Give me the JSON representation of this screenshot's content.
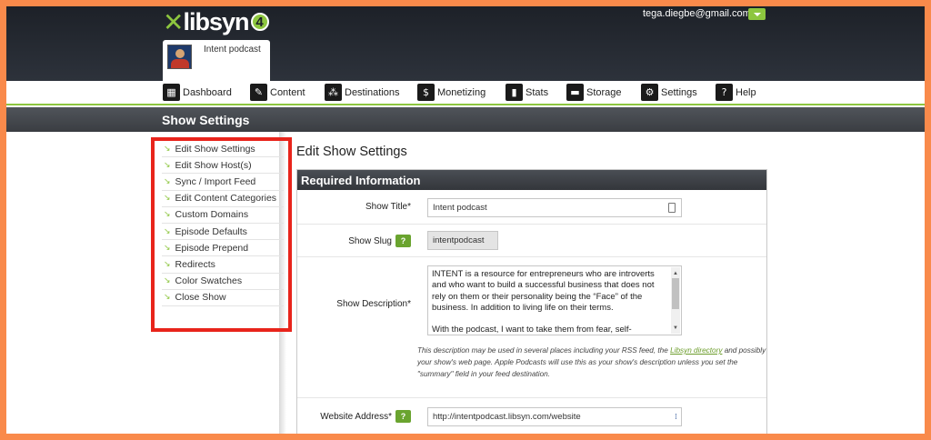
{
  "header": {
    "logo": "libsyn",
    "logo_version": "4",
    "user_email": "tega.diegbe@gmail.com",
    "show_name": "Intent podcast"
  },
  "nav": [
    {
      "label": "Dashboard",
      "icon": "grid-icon"
    },
    {
      "label": "Content",
      "icon": "content-icon"
    },
    {
      "label": "Destinations",
      "icon": "destinations-icon"
    },
    {
      "label": "Monetizing",
      "icon": "dollar-icon"
    },
    {
      "label": "Stats",
      "icon": "bar-chart-icon"
    },
    {
      "label": "Storage",
      "icon": "storage-icon"
    },
    {
      "label": "Settings",
      "icon": "gear-icon"
    },
    {
      "label": "Help",
      "icon": "question-icon"
    }
  ],
  "page_title": "Show Settings",
  "sidebar": {
    "items": [
      {
        "label": "Edit Show Settings"
      },
      {
        "label": "Edit Show Host(s)"
      },
      {
        "label": "Sync / Import Feed"
      },
      {
        "label": "Edit Content Categories"
      },
      {
        "label": "Custom Domains"
      },
      {
        "label": "Episode Defaults"
      },
      {
        "label": "Episode Prepend"
      },
      {
        "label": "Redirects"
      },
      {
        "label": "Color Swatches"
      },
      {
        "label": "Close Show"
      }
    ],
    "highlight_color": "#e8241b"
  },
  "main": {
    "title": "Edit Show Settings",
    "panel_title": "Required Information",
    "help_label": "?",
    "show_title": {
      "label": "Show Title*",
      "value": "Intent podcast"
    },
    "show_slug": {
      "label": "Show Slug",
      "value": "intentpodcast"
    },
    "show_description": {
      "label": "Show Description*",
      "paragraph1": "INTENT is a resource for entrepreneurs who are introverts and who want to build a successful business that does not rely on them or their personality being the “Face” of the business. In addition to living life on their terms.",
      "paragraph2": "With the podcast, I want to take them from fear, self-",
      "note_before": "This description may be used in several places including your RSS feed, the ",
      "note_link": "Libsyn directory",
      "note_after": " and possibly your show's web page. Apple Podcasts will use this as your show's description unless you set the \"summary\" field in your feed destination."
    },
    "website": {
      "label": "Website Address*",
      "value": "http://intentpodcast.libsyn.com/website"
    }
  },
  "colors": {
    "accent": "#8dc63f",
    "header_dark": "#2d323b",
    "frame": "#f98a4b"
  }
}
